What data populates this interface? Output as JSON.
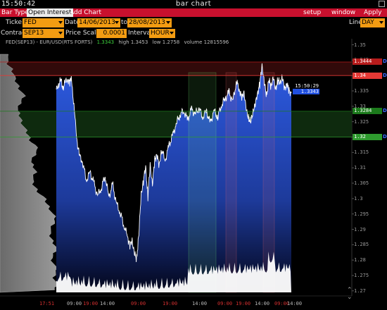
{
  "window": {
    "clock": "15:50:42",
    "title": "bar chart"
  },
  "menu": {
    "bar_type": "Bar Type",
    "open_interest": "Open Interest",
    "add_chart": "Add Chart",
    "setup": "setup",
    "window": "window",
    "apply": "Apply"
  },
  "params": {
    "ticker_label": "Ticker",
    "ticker_value": "FED",
    "date_label": "Date",
    "date_from": "14/06/2013",
    "to_label": "to",
    "date_to": "28/08/2013",
    "line_label": "Line",
    "line_value": "DAY",
    "contract_label": "Contract",
    "contract_value": "SEP13",
    "price_scale_label": "Price Scale",
    "price_scale_value": "0.0001",
    "interval_label": "Interval",
    "interval_value": "HOUR"
  },
  "caption": {
    "name": "FED(SEP13) - EUR/USD(RTS FORTS)",
    "last": "1.3343",
    "high": "high 1.3453",
    "low": "low 1.2758",
    "volume": "volume 12815596"
  },
  "y_ticks": [
    "1.35",
    "1.345",
    "1.34",
    "1.335",
    "1.33",
    "1.325",
    "1.32",
    "1.315",
    "1.31",
    "1.305",
    "1.3",
    "1.295",
    "1.29",
    "1.285",
    "1.28",
    "1.275",
    "1.27"
  ],
  "levels": [
    {
      "label": "1.3444",
      "tag": "D",
      "color": "#b71c1c",
      "value": 1.3444
    },
    {
      "label": "1.34",
      "tag": "D",
      "color": "#e53935",
      "value": 1.34
    },
    {
      "label": "1.3284",
      "tag": "D",
      "color": "#1b7a1b",
      "value": 1.3284
    },
    {
      "label": "1.32",
      "tag": "D",
      "color": "#2e9b2e",
      "value": 1.32
    }
  ],
  "current": {
    "time": "15:50:29",
    "price": "1.3343"
  },
  "x_ticks": [
    {
      "label": "17:51",
      "red": true
    },
    {
      "label": "09:00",
      "red": false
    },
    {
      "label": "19:00",
      "red": true
    },
    {
      "label": "14:00",
      "red": false
    },
    {
      "label": "09:00",
      "red": true
    },
    {
      "label": "19:00",
      "red": true
    },
    {
      "label": "14:00",
      "red": false
    },
    {
      "label": "09:00",
      "red": true
    },
    {
      "label": "19:00",
      "red": true
    },
    {
      "label": "14:00",
      "red": false
    },
    {
      "label": "09:00",
      "red": true
    },
    {
      "label": "14:00",
      "red": false
    }
  ],
  "colors": {
    "menu": "#c8102e",
    "field": "#f39c12",
    "price_line": "#ffffff",
    "fill_top": "#2d5be3",
    "fill_bottom": "#000010",
    "resistance": "#e53935",
    "support": "#2e9b2e"
  },
  "chart_data": {
    "type": "line",
    "title": "FED(SEP13) - EUR/USD(RTS FORTS)",
    "ylim": [
      1.2695,
      1.3515
    ],
    "price_anchors": [
      [
        0,
        1.3355
      ],
      [
        3,
        1.337
      ],
      [
        6,
        1.3385
      ],
      [
        9,
        1.336
      ],
      [
        12,
        1.338
      ],
      [
        15,
        1.3388
      ],
      [
        18,
        1.3375
      ],
      [
        20,
        1.3395
      ],
      [
        22,
        1.334
      ],
      [
        25,
        1.326
      ],
      [
        28,
        1.318
      ],
      [
        31,
        1.3138
      ],
      [
        35,
        1.312
      ],
      [
        40,
        1.306
      ],
      [
        45,
        1.3085
      ],
      [
        50,
        1.305
      ],
      [
        55,
        1.301
      ],
      [
        60,
        1.3035
      ],
      [
        65,
        1.3075
      ],
      [
        70,
        1.3005
      ],
      [
        75,
        1.3045
      ],
      [
        80,
        1.2985
      ],
      [
        85,
        1.2955
      ],
      [
        90,
        1.2915
      ],
      [
        95,
        1.2875
      ],
      [
        98,
        1.2845
      ],
      [
        101,
        1.2865
      ],
      [
        104,
        1.282
      ],
      [
        107,
        1.2805
      ],
      [
        110,
        1.2885
      ],
      [
        113,
        1.3015
      ],
      [
        116,
        1.3055
      ],
      [
        119,
        1.3105
      ],
      [
        122,
        1.3005
      ],
      [
        125,
        1.311
      ],
      [
        128,
        1.3045
      ],
      [
        131,
        1.3125
      ],
      [
        134,
        1.3145
      ],
      [
        137,
        1.3105
      ],
      [
        140,
        1.316
      ],
      [
        145,
        1.3125
      ],
      [
        150,
        1.3172
      ],
      [
        155,
        1.3205
      ],
      [
        160,
        1.3245
      ],
      [
        165,
        1.3275
      ],
      [
        170,
        1.3285
      ],
      [
        175,
        1.3255
      ],
      [
        180,
        1.329
      ],
      [
        185,
        1.3275
      ],
      [
        190,
        1.3295
      ],
      [
        195,
        1.3265
      ],
      [
        200,
        1.3285
      ],
      [
        205,
        1.3245
      ],
      [
        210,
        1.3285
      ],
      [
        215,
        1.3265
      ],
      [
        220,
        1.3305
      ],
      [
        225,
        1.3325
      ],
      [
        230,
        1.3345
      ],
      [
        235,
        1.3315
      ],
      [
        240,
        1.338
      ],
      [
        244,
        1.3355
      ],
      [
        247,
        1.3325
      ],
      [
        250,
        1.335
      ],
      [
        253,
        1.3285
      ],
      [
        256,
        1.3265
      ],
      [
        259,
        1.3245
      ],
      [
        262,
        1.3285
      ],
      [
        265,
        1.3305
      ],
      [
        268,
        1.3345
      ],
      [
        271,
        1.337
      ],
      [
        274,
        1.3435
      ],
      [
        277,
        1.3375
      ],
      [
        280,
        1.3335
      ],
      [
        283,
        1.3385
      ],
      [
        286,
        1.3365
      ],
      [
        289,
        1.3395
      ],
      [
        292,
        1.3355
      ],
      [
        295,
        1.3385
      ],
      [
        298,
        1.3375
      ],
      [
        301,
        1.3395
      ],
      [
        304,
        1.3355
      ],
      [
        307,
        1.3375
      ],
      [
        310,
        1.335
      ],
      [
        313,
        1.3343
      ]
    ],
    "volume_profile": [
      0.15,
      0.12,
      0.1,
      0.08,
      0.1,
      0.14,
      0.18,
      0.2,
      0.22,
      0.23,
      0.22,
      0.25,
      0.28,
      0.3,
      0.32,
      0.35,
      0.38,
      0.4,
      0.38,
      0.35,
      0.33,
      0.32,
      0.3,
      0.28,
      0.3,
      0.32,
      0.34,
      0.35,
      0.37,
      0.39,
      0.41,
      0.43,
      0.45,
      0.48,
      0.5,
      0.52,
      0.55,
      0.6,
      0.62,
      0.65,
      0.62,
      0.6,
      0.58,
      0.55,
      0.52,
      0.55,
      0.58,
      0.6,
      0.62,
      0.6,
      0.58,
      0.56,
      0.55,
      0.57,
      0.6,
      0.63,
      0.66,
      0.7,
      0.75,
      0.78,
      0.8,
      0.82,
      0.85,
      0.88,
      0.9,
      0.92,
      0.95,
      0.97,
      0.96,
      0.94,
      0.92,
      0.9,
      0.88,
      0.86,
      0.88,
      0.9,
      0.92,
      0.95,
      0.98,
      1.0,
      0.98,
      0.95,
      0.93,
      0.9,
      0.92,
      0.94,
      0.96,
      0.98,
      1.0,
      0.98,
      0.96,
      0.95,
      0.97,
      0.99,
      1.0,
      0.98,
      0.96
    ]
  }
}
